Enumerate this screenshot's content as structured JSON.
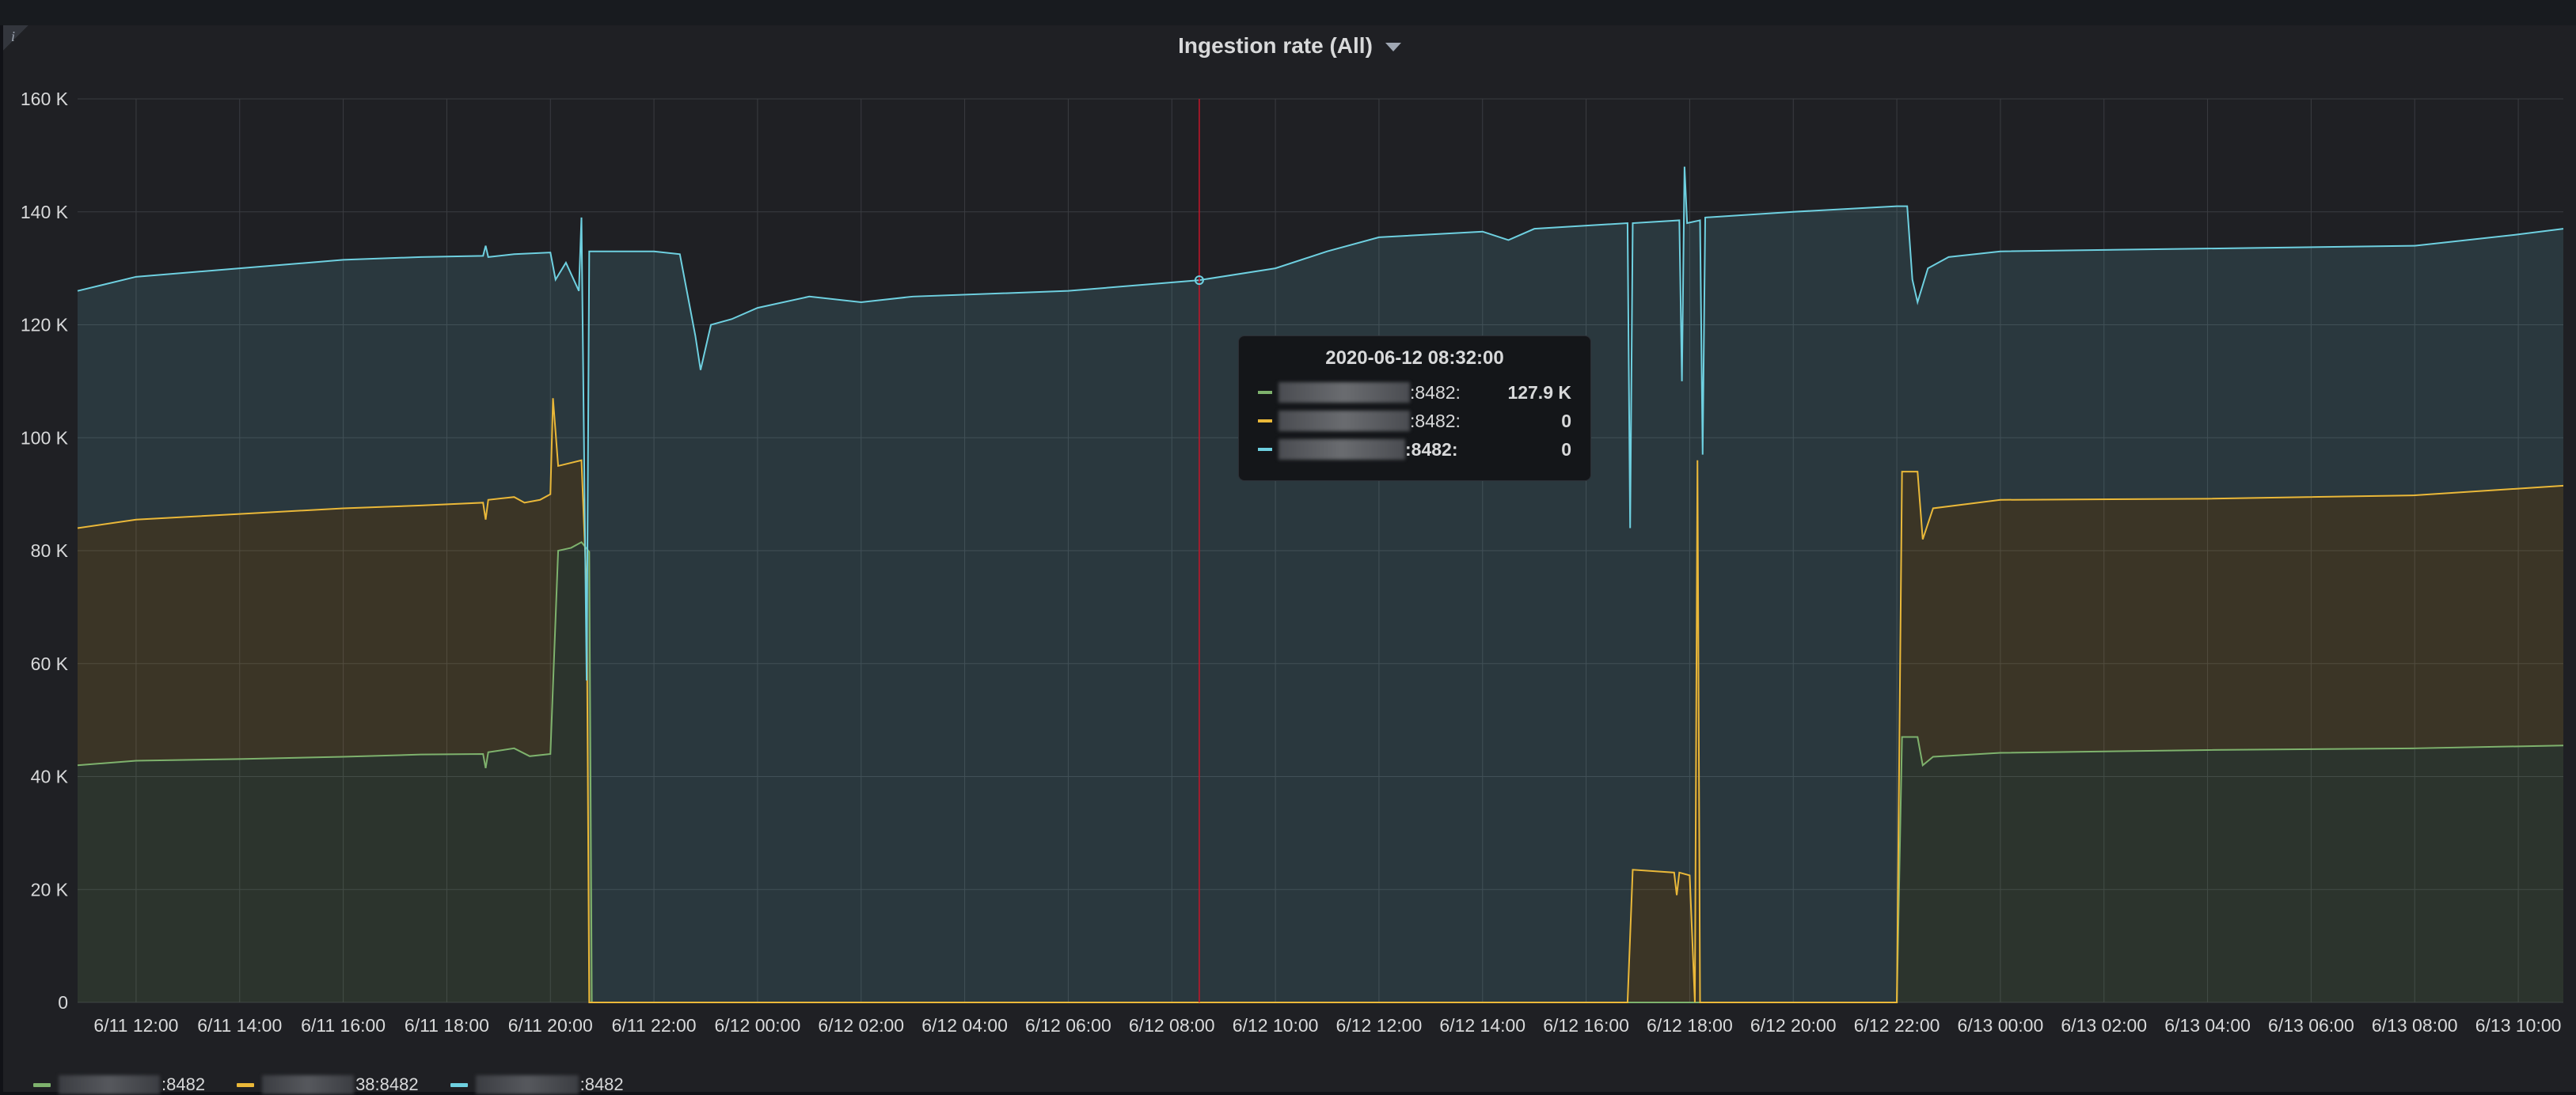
{
  "panel": {
    "title": "Ingestion rate (All)",
    "info_icon": "info-icon",
    "dropdown_icon": "caret-down-icon"
  },
  "tooltip": {
    "time": "2020-06-12 08:32:00",
    "rows": [
      {
        "name": ":8482:",
        "value": "127.9 K",
        "color": "#7eb26d"
      },
      {
        "name": ":8482:",
        "value": "0",
        "color": "#eab839"
      },
      {
        "name": ":8482:",
        "value": "0",
        "color": "#6ed0e0"
      }
    ]
  },
  "legend": [
    {
      "name": ":8482",
      "color": "#7eb26d"
    },
    {
      "name": "38:8482",
      "color": "#eab839"
    },
    {
      "name": ":8482",
      "color": "#6ed0e0"
    }
  ],
  "colors": {
    "green": "#7eb26d",
    "yellow": "#eab839",
    "blue": "#6ed0e0",
    "crosshair": "#c4162a"
  },
  "chart_data": {
    "type": "area",
    "stacked": true,
    "title": "Ingestion rate (All)",
    "y_tick_labels": [
      "0",
      "20 K",
      "40 K",
      "60 K",
      "80 K",
      "100 K",
      "120 K",
      "140 K",
      "160 K"
    ],
    "ylim": [
      0,
      160000
    ],
    "x_tick_labels": [
      "6/11 12:00",
      "6/11 14:00",
      "6/11 16:00",
      "6/11 18:00",
      "6/11 20:00",
      "6/11 22:00",
      "6/12 00:00",
      "6/12 02:00",
      "6/12 04:00",
      "6/12 06:00",
      "6/12 08:00",
      "6/12 10:00",
      "6/12 12:00",
      "6/12 14:00",
      "6/12 16:00",
      "6/12 18:00",
      "6/12 20:00",
      "6/12 22:00",
      "6/13 00:00",
      "6/13 02:00",
      "6/13 04:00",
      "6/13 06:00",
      "6/13 08:00",
      "6/13 10:00"
    ],
    "x_unit": "hours since 6/11 00:00",
    "xlim": [
      10.87,
      58.87
    ],
    "crosshair_x": 32.53,
    "grid": true,
    "legend_position": "bottom-left",
    "series": [
      {
        "color": "#7eb26d",
        "points": [
          [
            10.87,
            42000
          ],
          [
            12,
            42800
          ],
          [
            14,
            43100
          ],
          [
            16,
            43500
          ],
          [
            17.5,
            43900
          ],
          [
            18.7,
            44000
          ],
          [
            18.75,
            41500
          ],
          [
            18.8,
            44300
          ],
          [
            19.3,
            45000
          ],
          [
            19.6,
            43600
          ],
          [
            20.0,
            44000
          ],
          [
            20.15,
            80000
          ],
          [
            20.4,
            80500
          ],
          [
            20.6,
            81500
          ],
          [
            20.75,
            79800
          ],
          [
            20.8,
            0
          ],
          [
            32.53,
            0
          ],
          [
            46.0,
            0
          ],
          [
            46.1,
            47000
          ],
          [
            46.4,
            47000
          ],
          [
            46.5,
            42000
          ],
          [
            46.7,
            43500
          ],
          [
            48,
            44200
          ],
          [
            52,
            44700
          ],
          [
            56,
            45000
          ],
          [
            58.87,
            45500
          ]
        ]
      },
      {
        "color": "#eab839",
        "points": [
          [
            10.87,
            84000
          ],
          [
            12,
            85500
          ],
          [
            14,
            86500
          ],
          [
            16,
            87500
          ],
          [
            17.5,
            88000
          ],
          [
            18.7,
            88500
          ],
          [
            18.75,
            85500
          ],
          [
            18.8,
            89000
          ],
          [
            19.3,
            89500
          ],
          [
            19.5,
            88500
          ],
          [
            19.8,
            89000
          ],
          [
            20.0,
            90000
          ],
          [
            20.05,
            107000
          ],
          [
            20.15,
            95000
          ],
          [
            20.6,
            96000
          ],
          [
            20.7,
            73000
          ],
          [
            20.75,
            0
          ],
          [
            32.53,
            0
          ],
          [
            40.8,
            0
          ],
          [
            40.9,
            23500
          ],
          [
            41.7,
            23000
          ],
          [
            41.75,
            19000
          ],
          [
            41.8,
            23000
          ],
          [
            42.0,
            22500
          ],
          [
            42.1,
            0
          ],
          [
            42.15,
            96000
          ],
          [
            42.2,
            0
          ],
          [
            46.0,
            0
          ],
          [
            46.1,
            94000
          ],
          [
            46.4,
            94000
          ],
          [
            46.5,
            82000
          ],
          [
            46.7,
            87500
          ],
          [
            48,
            89000
          ],
          [
            52,
            89200
          ],
          [
            56,
            89800
          ],
          [
            58.87,
            91500
          ]
        ]
      },
      {
        "color": "#6ed0e0",
        "points": [
          [
            10.87,
            126000
          ],
          [
            12,
            128500
          ],
          [
            14,
            130000
          ],
          [
            16,
            131500
          ],
          [
            17.5,
            132000
          ],
          [
            18.7,
            132200
          ],
          [
            18.75,
            134000
          ],
          [
            18.8,
            132000
          ],
          [
            19.3,
            132500
          ],
          [
            20.0,
            132800
          ],
          [
            20.1,
            128000
          ],
          [
            20.3,
            131000
          ],
          [
            20.55,
            126000
          ],
          [
            20.6,
            139000
          ],
          [
            20.7,
            57000
          ],
          [
            20.75,
            133000
          ],
          [
            22.0,
            133000
          ],
          [
            22.5,
            132500
          ],
          [
            22.8,
            118000
          ],
          [
            22.9,
            112000
          ],
          [
            23.1,
            120000
          ],
          [
            23.5,
            121000
          ],
          [
            24.0,
            123000
          ],
          [
            25.0,
            125000
          ],
          [
            26.0,
            124000
          ],
          [
            27.0,
            125000
          ],
          [
            30.0,
            126000
          ],
          [
            32.53,
            127900
          ],
          [
            34.0,
            130000
          ],
          [
            35.0,
            133000
          ],
          [
            36.0,
            135500
          ],
          [
            38.0,
            136500
          ],
          [
            38.5,
            135000
          ],
          [
            39.0,
            137000
          ],
          [
            40.8,
            138000
          ],
          [
            40.85,
            84000
          ],
          [
            40.9,
            138000
          ],
          [
            41.8,
            138500
          ],
          [
            41.85,
            110000
          ],
          [
            41.9,
            148000
          ],
          [
            41.95,
            138000
          ],
          [
            42.2,
            138500
          ],
          [
            42.25,
            97000
          ],
          [
            42.3,
            139000
          ],
          [
            44.0,
            140000
          ],
          [
            46.0,
            141000
          ],
          [
            46.2,
            141000
          ],
          [
            46.3,
            128000
          ],
          [
            46.4,
            124000
          ],
          [
            46.6,
            130000
          ],
          [
            47.0,
            132000
          ],
          [
            48.0,
            133000
          ],
          [
            52.0,
            133500
          ],
          [
            56.0,
            134000
          ],
          [
            58.0,
            136000
          ],
          [
            58.87,
            137000
          ]
        ]
      }
    ]
  }
}
